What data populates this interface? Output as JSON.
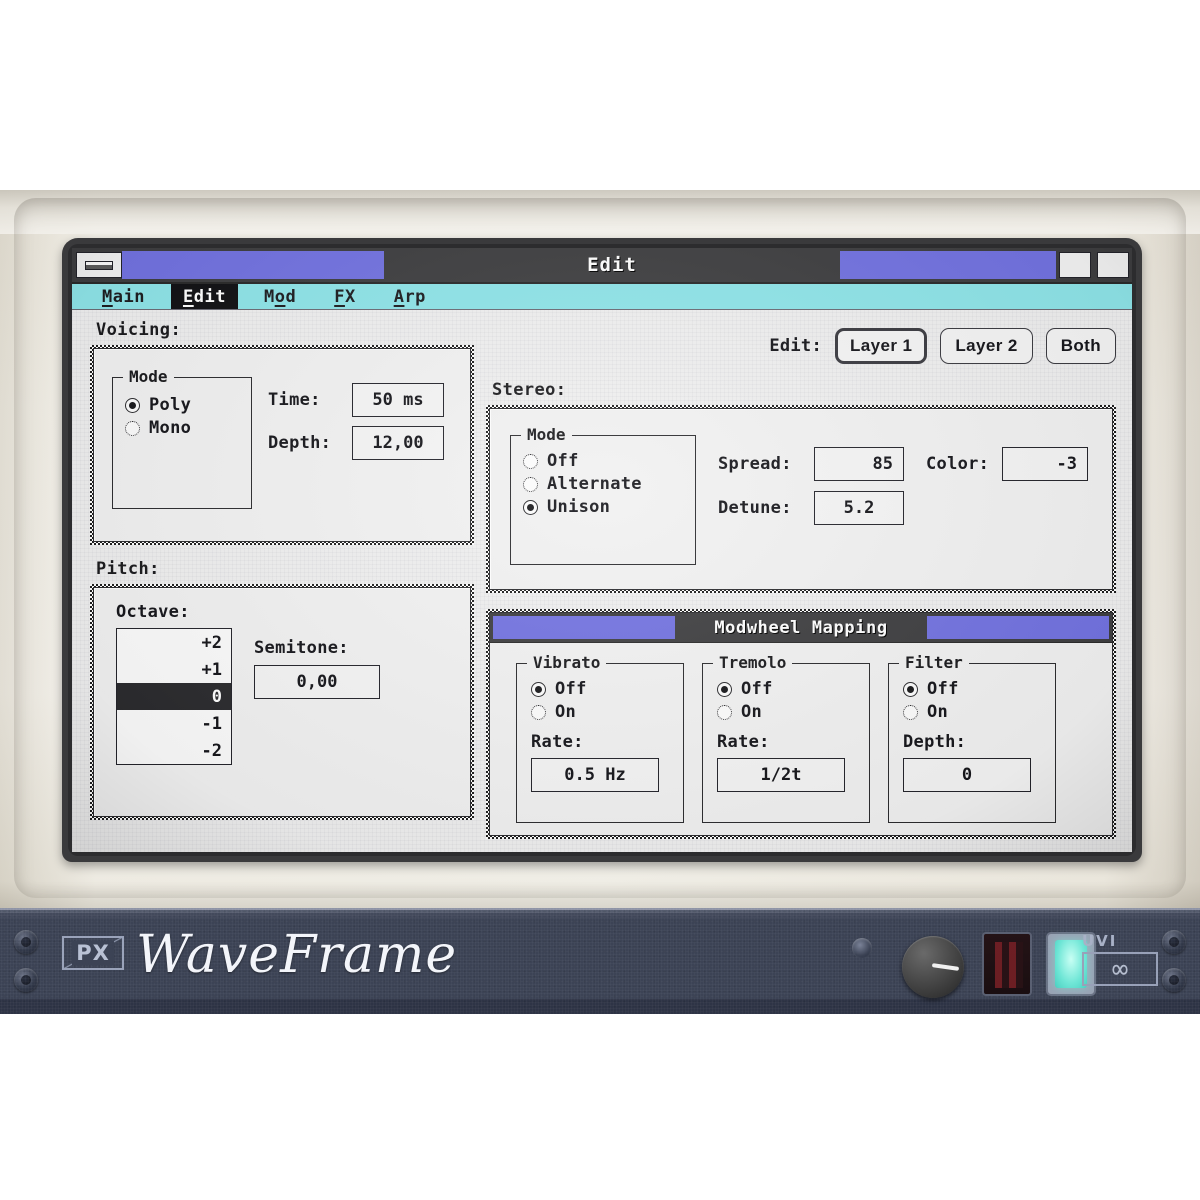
{
  "window": {
    "title": "Edit",
    "close_box": "close-box",
    "zoom_boxes": 2
  },
  "menubar": {
    "items": [
      {
        "label": "Main",
        "mnemonic_index": 0,
        "active": false
      },
      {
        "label": "Edit",
        "mnemonic_index": 0,
        "active": true
      },
      {
        "label": "Mod",
        "mnemonic_index": 1,
        "active": false
      },
      {
        "label": "FX",
        "mnemonic_index": 0,
        "active": false
      },
      {
        "label": "Arp",
        "mnemonic_index": 0,
        "active": false
      }
    ]
  },
  "layer_selector": {
    "label": "Edit:",
    "buttons": [
      {
        "label": "Layer 1",
        "selected": true
      },
      {
        "label": "Layer 2",
        "selected": false
      },
      {
        "label": "Both",
        "selected": false
      }
    ]
  },
  "voicing": {
    "section_label": "Voicing:",
    "mode_group_label": "Mode",
    "mode_options": [
      {
        "label": "Poly",
        "selected": true
      },
      {
        "label": "Mono",
        "selected": false
      }
    ],
    "time_label": "Time:",
    "time_value": "50 ms",
    "depth_label": "Depth:",
    "depth_value": "12,00"
  },
  "pitch": {
    "section_label": "Pitch:",
    "octave_label": "Octave:",
    "octave_options": [
      "+2",
      "+1",
      "0",
      "-1",
      "-2"
    ],
    "octave_selected": "0",
    "semitone_label": "Semitone:",
    "semitone_value": "0,00"
  },
  "stereo": {
    "section_label": "Stereo:",
    "mode_group_label": "Mode",
    "mode_options": [
      {
        "label": "Off",
        "selected": false
      },
      {
        "label": "Alternate",
        "selected": false
      },
      {
        "label": "Unison",
        "selected": true
      }
    ],
    "spread_label": "Spread:",
    "spread_value": "85",
    "detune_label": "Detune:",
    "detune_value": "5.2",
    "color_label": "Color:",
    "color_value": "-3"
  },
  "modwheel": {
    "title": "Modwheel Mapping",
    "groups": [
      {
        "name": "Vibrato",
        "options": [
          {
            "label": "Off",
            "selected": true
          },
          {
            "label": "On",
            "selected": false
          }
        ],
        "param_label": "Rate:",
        "param_value": "0.5 Hz"
      },
      {
        "name": "Tremolo",
        "options": [
          {
            "label": "Off",
            "selected": true
          },
          {
            "label": "On",
            "selected": false
          }
        ],
        "param_label": "Rate:",
        "param_value": "1/2t"
      },
      {
        "name": "Filter",
        "options": [
          {
            "label": "Off",
            "selected": true
          },
          {
            "label": "On",
            "selected": false
          }
        ],
        "param_label": "Depth:",
        "param_value": "0"
      }
    ]
  },
  "hardware": {
    "brand_mark": "PX",
    "product_name": "WaveFrame",
    "vendor_logo_text": "UVI",
    "vendor_logo_glyph": "∞"
  },
  "colors": {
    "titlebar_accent": "#7272E0",
    "menubar": "#8EE4E8",
    "titlebar_bg": "#3E3E40",
    "screen_bg": "#EFEFEF",
    "ink": "#15151A",
    "cyan_lamp": "#6FE6D6"
  }
}
